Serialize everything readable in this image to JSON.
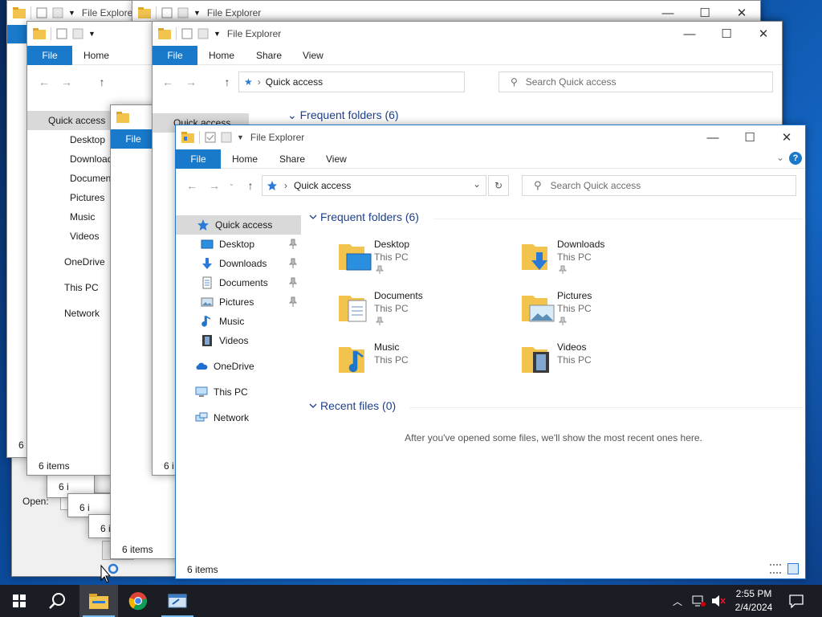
{
  "app_title": "File Explorer",
  "ribbon_tabs": [
    "File",
    "Home",
    "Share",
    "View"
  ],
  "address": {
    "location": "Quick access"
  },
  "search": {
    "placeholder": "Search Quick access"
  },
  "nav": {
    "quick_access": "Quick access",
    "children": [
      {
        "label": "Desktop",
        "icon": "desktop-icon",
        "pinned": true
      },
      {
        "label": "Downloads",
        "icon": "downloads-icon",
        "pinned": true
      },
      {
        "label": "Documents",
        "icon": "documents-icon",
        "pinned": true
      },
      {
        "label": "Pictures",
        "icon": "pictures-icon",
        "pinned": true
      },
      {
        "label": "Music",
        "icon": "music-icon",
        "pinned": false
      },
      {
        "label": "Videos",
        "icon": "videos-icon",
        "pinned": false
      }
    ],
    "onedrive": "OneDrive",
    "this_pc": "This PC",
    "network": "Network"
  },
  "frequent": {
    "header": "Frequent folders (6)",
    "folders": [
      {
        "name": "Desktop",
        "location": "This PC",
        "pinned": true,
        "icon": "desktop-folder-icon"
      },
      {
        "name": "Downloads",
        "location": "This PC",
        "pinned": true,
        "icon": "downloads-folder-icon"
      },
      {
        "name": "Documents",
        "location": "This PC",
        "pinned": true,
        "icon": "documents-folder-icon"
      },
      {
        "name": "Pictures",
        "location": "This PC",
        "pinned": true,
        "icon": "pictures-folder-icon"
      },
      {
        "name": "Music",
        "location": "This PC",
        "pinned": false,
        "icon": "music-folder-icon"
      },
      {
        "name": "Videos",
        "location": "This PC",
        "pinned": false,
        "icon": "videos-folder-icon"
      }
    ]
  },
  "recent": {
    "header": "Recent files (0)",
    "empty_message": "After you've opened some files, we'll show the most recent ones here."
  },
  "status": {
    "item_count": "6 items",
    "item_count_partial": "6 i"
  },
  "run_dialog": {
    "open_label": "Open:"
  },
  "taskbar": {
    "time": "2:55 PM",
    "date": "2/4/2024",
    "items": [
      "start-icon",
      "search-icon",
      "file-explorer-icon",
      "chrome-icon",
      "run-dialog-icon"
    ]
  },
  "colors": {
    "accent": "#1979ca",
    "group_header": "#1e3f8a",
    "taskbar": "#1a1d24"
  }
}
